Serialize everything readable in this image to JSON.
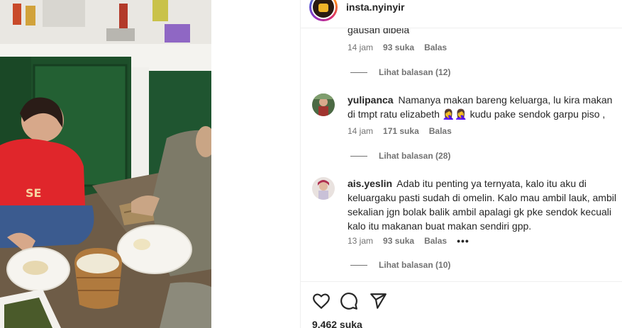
{
  "post": {
    "username": "insta.nyinyir",
    "likes_count": "9.462 suka"
  },
  "comments_panel": {
    "truncated_text": "gausah dibela",
    "first_meta": {
      "time": "14 jam",
      "likes": "93 suka",
      "reply": "Balas"
    },
    "first_replies": "Lihat balasan (12)",
    "comments": [
      {
        "username": "yulipanca",
        "text": "Namanya makan bareng keluarga, lu kira makan di tmpt ratu elizabeth 🤦‍♀️🤦‍♀️ kudu pake sendok garpu piso ,",
        "time": "14 jam",
        "likes": "171 suka",
        "reply": "Balas",
        "replies": "Lihat balasan (28)"
      },
      {
        "username": "ais.yeslin",
        "text": "Adab itu penting ya ternyata, kalo itu aku di keluargaku pasti sudah di omelin. Kalo mau ambil lauk, ambil sekalian jgn bolak balik ambil apalagi gk pke sendok kecuali kalo itu makanan buat makan sendiri gpp.",
        "time": "13 jam",
        "likes": "93 suka",
        "reply": "Balas",
        "more": "•••",
        "replies": "Lihat balasan (10)"
      }
    ]
  },
  "icons": {
    "like": "heart-icon",
    "comment": "comment-icon",
    "share": "share-icon",
    "more": "more-options-icon"
  },
  "colors": {
    "text_primary": "#262626",
    "text_secondary": "#737373",
    "divider": "#efefef"
  }
}
